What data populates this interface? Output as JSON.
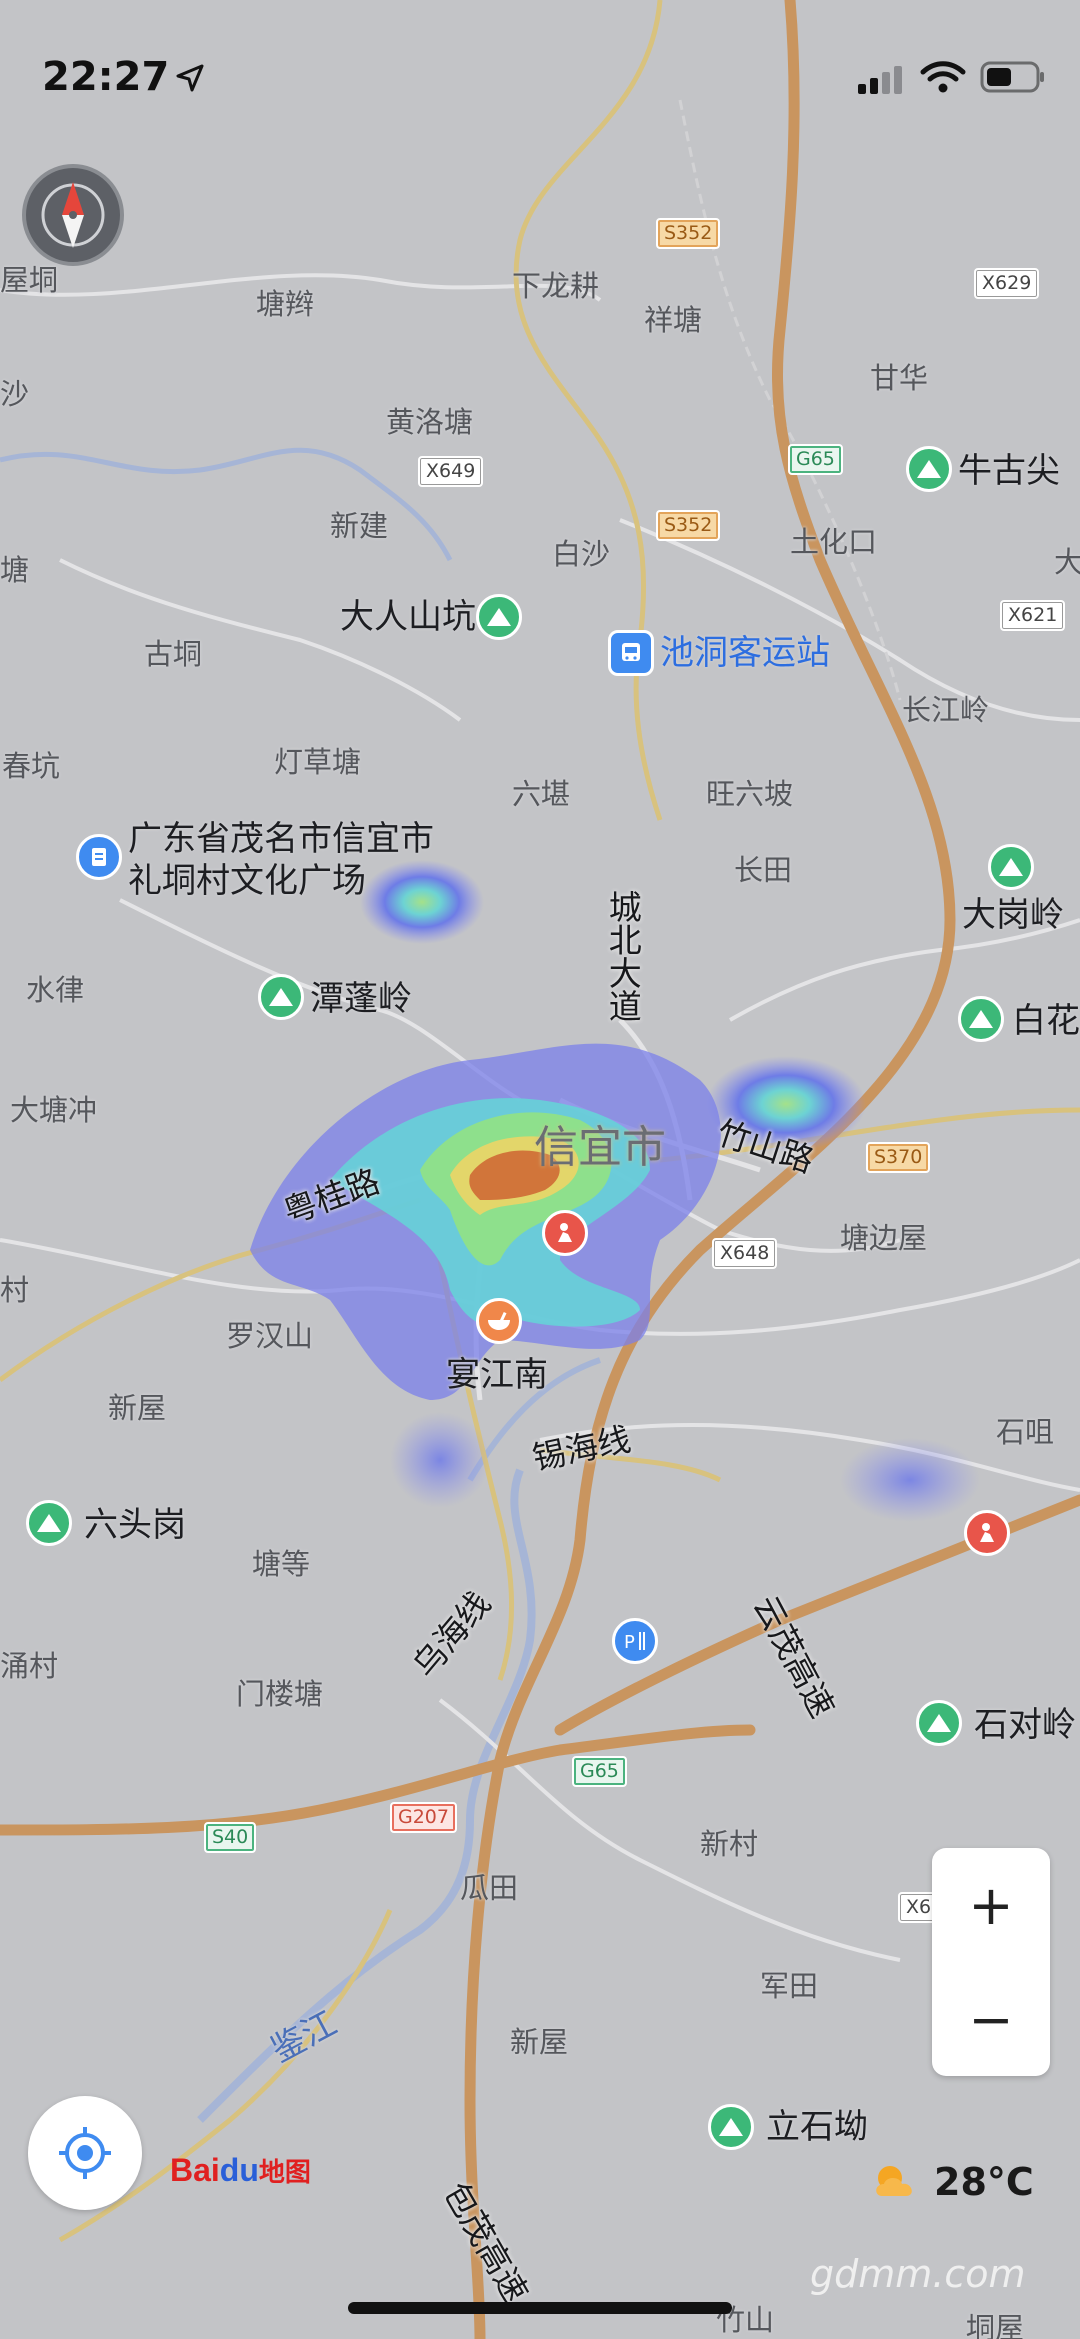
{
  "status": {
    "time": "22:27"
  },
  "colors": {
    "land": "#c3c4c7",
    "expressway": "#c9955f",
    "road": "#e4e4e6",
    "river": "#a6b5d6",
    "accent": "#3f8bf0"
  },
  "labels": {
    "wutang": "塘辫",
    "xialonggeng": "下龙耕",
    "xiangtang": "祥塘",
    "ganhua": "甘华",
    "huangluotang": "黄洛塘",
    "niugudui": "牛古尖",
    "xinjian": "新建",
    "baisha": "白沙",
    "tuhuakou": "土化口",
    "darenshankeng": "大人山坑",
    "chidongkeyunzhan": "池洞客运站",
    "gukeng": "古垌",
    "changjiangling": "长江岭",
    "chunkeng": "春坑",
    "dengcaotang": "灯草塘",
    "liukan": "六堪",
    "wangliupo": "旺六坡",
    "guangdong_square_1": "广东省茂名市信宜市",
    "guangdong_square_2": "礼垌村文化广场",
    "changtian": "长田",
    "dagangling": "大岗岭",
    "shuilv": "水律",
    "tanpengling": "潭蓬岭",
    "baihua": "白花",
    "datangchong": "大塘冲",
    "xinyishi": "信宜市",
    "tangbianwu": "塘边屋",
    "luohanshan": "罗汉山",
    "xinwu": "新屋",
    "yanjiangnan": "宴江南",
    "shitan": "石咀",
    "liutougang": "六头岗",
    "tangdeng": "塘等",
    "menloutang": "门楼塘",
    "shiduiling": "石对岭",
    "xincun": "新村",
    "guatian": "瓜田",
    "juntian": "军田",
    "xinwu2": "新屋",
    "lishiao": "立石坳",
    "zhushan": "竹山",
    "tongwu": "垌屋",
    "jianjiang": "鉴江",
    "left1": "屋垌",
    "left2": "沙",
    "left3": "塘",
    "left4": "村",
    "left5": "涌村",
    "right1": "大"
  },
  "roads": {
    "chengbei": "城北大道",
    "zhushanlu": "竹山路",
    "yueguilu": "粤桂路",
    "xihaixian": "锡海线",
    "wuhaixian": "乌海线",
    "yunmao": "云茂高速",
    "baomao": "包茂高速"
  },
  "shields": {
    "s352a": "S352",
    "x629": "X629",
    "g65a": "G65",
    "x649": "X649",
    "s352b": "S352",
    "x621": "X621",
    "s370": "S370",
    "x648": "X648",
    "g65b": "G65",
    "s40": "S40",
    "g207": "G207",
    "x6xx": "X6"
  },
  "controls": {
    "zoom_in": "+",
    "zoom_out": "−"
  },
  "logo": {
    "bai": "Bai",
    "du": "du",
    "ditu": "地图"
  },
  "weather": {
    "temp": "28°C",
    "icon": "partly-cloudy-icon"
  },
  "watermark": "gdmm.com"
}
